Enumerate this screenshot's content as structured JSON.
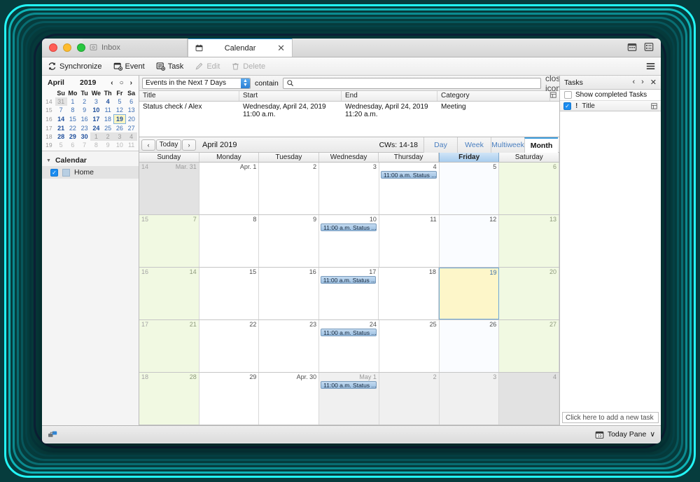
{
  "window": {
    "tabs": [
      {
        "label": "Inbox",
        "icon": "mail-icon",
        "active": false
      },
      {
        "label": "Calendar",
        "icon": "calendar-icon",
        "active": true
      }
    ],
    "right_icons": [
      "calendar-view-icon",
      "tasks-view-icon"
    ]
  },
  "toolbar": {
    "buttons": [
      {
        "label": "Synchronize",
        "icon": "sync-icon",
        "enabled": true
      },
      {
        "label": "Event",
        "icon": "new-event-icon",
        "enabled": true
      },
      {
        "label": "Task",
        "icon": "new-task-icon",
        "enabled": true
      },
      {
        "label": "Edit",
        "icon": "pencil-icon",
        "enabled": false
      },
      {
        "label": "Delete",
        "icon": "trash-icon",
        "enabled": false
      }
    ],
    "menu_icon": "hamburger-menu-icon"
  },
  "mini_calendar": {
    "month": "April",
    "year": "2019",
    "nav": {
      "prev": "‹",
      "today": "○",
      "next": "›"
    },
    "weekday_headers": [
      "Su",
      "Mo",
      "Tu",
      "We",
      "Th",
      "Fr",
      "Sa"
    ],
    "weeks": [
      {
        "wk": "14",
        "days": [
          {
            "n": "31",
            "state": "out-shade"
          },
          {
            "n": "1",
            "state": "in"
          },
          {
            "n": "2",
            "state": "in"
          },
          {
            "n": "3",
            "state": "in"
          },
          {
            "n": "4",
            "state": "bold"
          },
          {
            "n": "5",
            "state": "in"
          },
          {
            "n": "6",
            "state": "in"
          }
        ]
      },
      {
        "wk": "15",
        "days": [
          {
            "n": "7",
            "state": "in"
          },
          {
            "n": "8",
            "state": "in"
          },
          {
            "n": "9",
            "state": "in"
          },
          {
            "n": "10",
            "state": "bold"
          },
          {
            "n": "11",
            "state": "in"
          },
          {
            "n": "12",
            "state": "in"
          },
          {
            "n": "13",
            "state": "in"
          }
        ]
      },
      {
        "wk": "16",
        "days": [
          {
            "n": "14",
            "state": "bold"
          },
          {
            "n": "15",
            "state": "in"
          },
          {
            "n": "16",
            "state": "in"
          },
          {
            "n": "17",
            "state": "bold"
          },
          {
            "n": "18",
            "state": "in"
          },
          {
            "n": "19",
            "state": "today"
          },
          {
            "n": "20",
            "state": "in"
          }
        ]
      },
      {
        "wk": "17",
        "days": [
          {
            "n": "21",
            "state": "bold"
          },
          {
            "n": "22",
            "state": "in"
          },
          {
            "n": "23",
            "state": "in"
          },
          {
            "n": "24",
            "state": "bold"
          },
          {
            "n": "25",
            "state": "in"
          },
          {
            "n": "26",
            "state": "in"
          },
          {
            "n": "27",
            "state": "in"
          }
        ]
      },
      {
        "wk": "18",
        "days": [
          {
            "n": "28",
            "state": "bold"
          },
          {
            "n": "29",
            "state": "bold"
          },
          {
            "n": "30",
            "state": "bold"
          },
          {
            "n": "1",
            "state": "out-shade"
          },
          {
            "n": "2",
            "state": "out-shade"
          },
          {
            "n": "3",
            "state": "out-shade"
          },
          {
            "n": "4",
            "state": "out-shade"
          }
        ]
      },
      {
        "wk": "19",
        "days": [
          {
            "n": "5",
            "state": "out"
          },
          {
            "n": "6",
            "state": "out"
          },
          {
            "n": "7",
            "state": "out"
          },
          {
            "n": "8",
            "state": "out"
          },
          {
            "n": "9",
            "state": "out"
          },
          {
            "n": "10",
            "state": "out"
          },
          {
            "n": "11",
            "state": "out"
          }
        ]
      }
    ]
  },
  "calendar_list": {
    "section_label": "Calendar",
    "items": [
      {
        "label": "Home",
        "checked": true,
        "color": "#b8cfe3"
      }
    ]
  },
  "search": {
    "filter_value": "Events in the Next 7 Days",
    "contain_label": "contain",
    "input_value": "",
    "input_placeholder": "",
    "search_icon": "search-icon",
    "clear_icon": "close-icon"
  },
  "event_table": {
    "columns": [
      "Title",
      "Start",
      "End",
      "Category"
    ],
    "rows": [
      {
        "title": "Status check / Alex",
        "start": "Wednesday, April 24, 2019 11:00 a.m.",
        "end": "Wednesday, April 24, 2019 11:20 a.m.",
        "category": "Meeting"
      }
    ],
    "column_picker_icon": "column-picker-icon"
  },
  "calendar_nav": {
    "prev": "‹",
    "today_label": "Today",
    "next": "›",
    "period_label": "April 2019",
    "cws_label": "CWs: 14-18",
    "views": [
      {
        "label": "Day",
        "active": false
      },
      {
        "label": "Week",
        "active": false
      },
      {
        "label": "Multiweek",
        "active": false
      },
      {
        "label": "Month",
        "active": true
      }
    ]
  },
  "month_grid": {
    "day_headers": [
      {
        "label": "Sunday",
        "highlight": false
      },
      {
        "label": "Monday",
        "highlight": false
      },
      {
        "label": "Tuesday",
        "highlight": false
      },
      {
        "label": "Wednesday",
        "highlight": false
      },
      {
        "label": "Thursday",
        "highlight": false
      },
      {
        "label": "Friday",
        "highlight": true
      },
      {
        "label": "Saturday",
        "highlight": false
      }
    ],
    "weeks": [
      {
        "wk": "14",
        "cells": [
          {
            "num": "Mar. 31",
            "kind": "other-weekend"
          },
          {
            "num": "Apr. 1",
            "kind": "in"
          },
          {
            "num": "2",
            "kind": "in"
          },
          {
            "num": "3",
            "kind": "in"
          },
          {
            "num": "4",
            "kind": "in",
            "event": "11:00 a.m. Status ..."
          },
          {
            "num": "5",
            "kind": "fri"
          },
          {
            "num": "6",
            "kind": "weekend"
          }
        ]
      },
      {
        "wk": "15",
        "cells": [
          {
            "num": "7",
            "kind": "weekend"
          },
          {
            "num": "8",
            "kind": "in"
          },
          {
            "num": "9",
            "kind": "in"
          },
          {
            "num": "10",
            "kind": "in",
            "event": "11:00 a.m. Status ..."
          },
          {
            "num": "11",
            "kind": "in"
          },
          {
            "num": "12",
            "kind": "fri"
          },
          {
            "num": "13",
            "kind": "weekend"
          }
        ]
      },
      {
        "wk": "16",
        "cells": [
          {
            "num": "14",
            "kind": "weekend"
          },
          {
            "num": "15",
            "kind": "in"
          },
          {
            "num": "16",
            "kind": "in"
          },
          {
            "num": "17",
            "kind": "in",
            "event": "11:00 a.m. Status ..."
          },
          {
            "num": "18",
            "kind": "in"
          },
          {
            "num": "19",
            "kind": "today"
          },
          {
            "num": "20",
            "kind": "weekend"
          }
        ]
      },
      {
        "wk": "17",
        "cells": [
          {
            "num": "21",
            "kind": "weekend"
          },
          {
            "num": "22",
            "kind": "in"
          },
          {
            "num": "23",
            "kind": "in"
          },
          {
            "num": "24",
            "kind": "in",
            "event": "11:00 a.m. Status ..."
          },
          {
            "num": "25",
            "kind": "in"
          },
          {
            "num": "26",
            "kind": "fri"
          },
          {
            "num": "27",
            "kind": "weekend"
          }
        ]
      },
      {
        "wk": "18",
        "cells": [
          {
            "num": "28",
            "kind": "weekend"
          },
          {
            "num": "29",
            "kind": "in"
          },
          {
            "num": "Apr. 30",
            "kind": "in"
          },
          {
            "num": "May 1",
            "kind": "other",
            "event": "11:00 a.m. Status ..."
          },
          {
            "num": "2",
            "kind": "other"
          },
          {
            "num": "3",
            "kind": "other"
          },
          {
            "num": "4",
            "kind": "other-weekend"
          }
        ]
      }
    ]
  },
  "tasks": {
    "panel_title": "Tasks",
    "nav": {
      "prev": "‹",
      "next": "›",
      "close": "✕"
    },
    "show_completed": {
      "label": "Show completed Tasks",
      "checked": false
    },
    "header": {
      "checkbox_checked": true,
      "priority_icon": "!",
      "title_label": "Title",
      "column_picker_icon": "column-picker-icon"
    },
    "add_task_placeholder": "Click here to add a new task"
  },
  "status_bar": {
    "connection_icon": "network-icon",
    "today_pane_label": "Today Pane",
    "today_pane_icon": "today-calendar-icon",
    "chevron": "∨"
  }
}
